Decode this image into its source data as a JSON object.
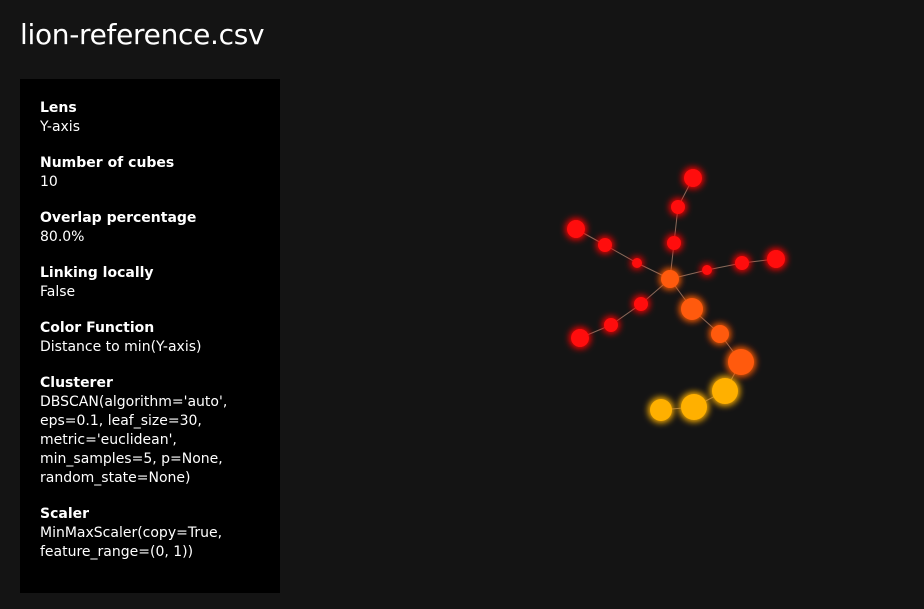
{
  "title": "lion-reference.csv",
  "params": [
    {
      "label": "Lens",
      "value": "Y-axis"
    },
    {
      "label": "Number of cubes",
      "value": "10"
    },
    {
      "label": "Overlap percentage",
      "value": "80.0%"
    },
    {
      "label": "Linking locally",
      "value": "False"
    },
    {
      "label": "Color Function",
      "value": "Distance to min(Y-axis)"
    },
    {
      "label": "Clusterer",
      "value": "DBSCAN(algorithm='auto',\neps=0.1, leaf_size=30,\nmetric='euclidean',\nmin_samples=5, p=None,\nrandom_state=None)"
    },
    {
      "label": "Scaler",
      "value": "MinMaxScaler(copy=True,\nfeature_range=(0, 1))"
    }
  ],
  "colors": {
    "background": "#141414",
    "panel": "#000000",
    "edge": "#8a6a5a",
    "node_low": "#ff0a0a",
    "node_mid": "#ff5a10",
    "node_high": "#ffb000"
  }
}
